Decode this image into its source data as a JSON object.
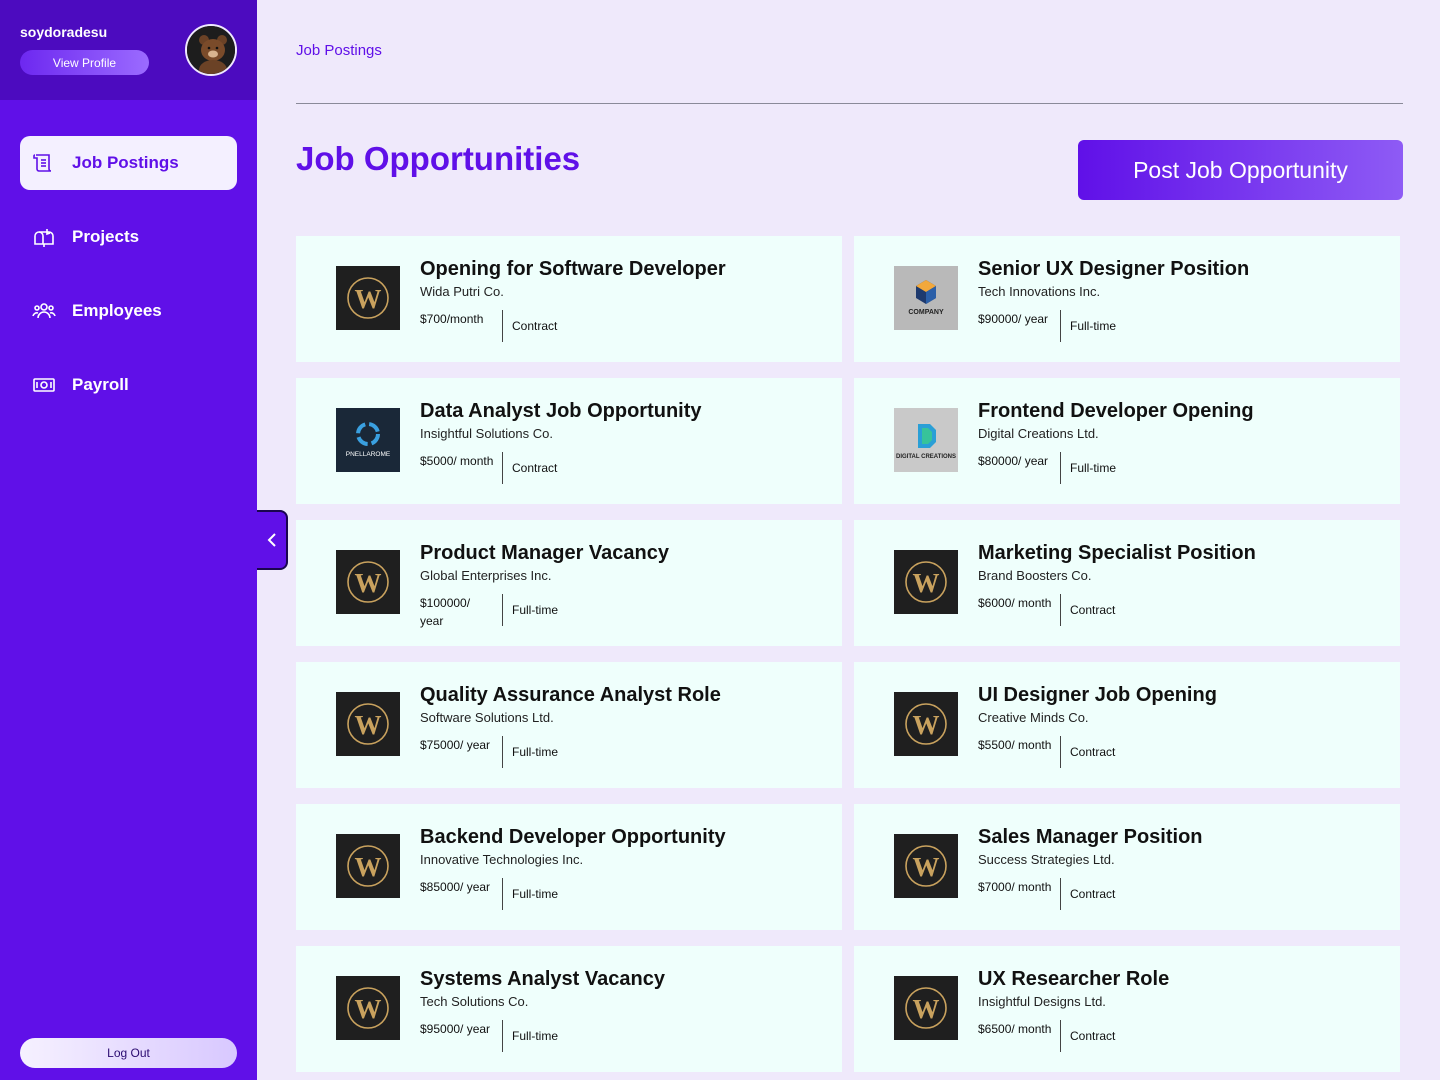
{
  "sidebar": {
    "username": "soydoradesu",
    "view_profile": "View Profile",
    "items": [
      {
        "label": "Job Postings",
        "icon": "scroll-icon"
      },
      {
        "label": "Projects",
        "icon": "mailbox-icon"
      },
      {
        "label": "Employees",
        "icon": "users-icon"
      },
      {
        "label": "Payroll",
        "icon": "cash-icon"
      }
    ],
    "logout": "Log Out"
  },
  "header": {
    "breadcrumb": "Job Postings",
    "title": "Job Opportunities",
    "post_button": "Post Job Opportunity"
  },
  "jobs": [
    {
      "title": "Opening for Software Developer",
      "company": "Wida Putri Co.",
      "salary": "$700/month",
      "type": "Contract",
      "logo": "w-logo"
    },
    {
      "title": "Senior UX Designer Position",
      "company": "Tech Innovations Inc.",
      "salary": "$90000/ year",
      "type": "Full-time",
      "logo": "company-cube-logo"
    },
    {
      "title": "Data Analyst Job Opportunity",
      "company": "Insightful Solutions Co.",
      "salary": "$5000/ month",
      "type": "Contract",
      "logo": "pnellarome-logo"
    },
    {
      "title": "Frontend Developer Opening",
      "company": "Digital Creations Ltd.",
      "salary": "$80000/ year",
      "type": "Full-time",
      "logo": "digital-creations-logo"
    },
    {
      "title": "Product Manager Vacancy",
      "company": "Global Enterprises Inc.",
      "salary": "$100000/ year",
      "type": "Full-time",
      "logo": "w-logo"
    },
    {
      "title": "Marketing Specialist Position",
      "company": "Brand Boosters Co.",
      "salary": "$6000/ month",
      "type": "Contract",
      "logo": "w-logo"
    },
    {
      "title": "Quality Assurance Analyst Role",
      "company": "Software Solutions Ltd.",
      "salary": "$75000/ year",
      "type": "Full-time",
      "logo": "w-logo"
    },
    {
      "title": "UI Designer Job Opening",
      "company": "Creative Minds Co.",
      "salary": "$5500/ month",
      "type": "Contract",
      "logo": "w-logo"
    },
    {
      "title": "Backend Developer Opportunity",
      "company": "Innovative Technologies Inc.",
      "salary": "$85000/ year",
      "type": "Full-time",
      "logo": "w-logo"
    },
    {
      "title": "Sales Manager Position",
      "company": "Success Strategies Ltd.",
      "salary": "$7000/ month",
      "type": "Contract",
      "logo": "w-logo"
    },
    {
      "title": "Systems Analyst Vacancy",
      "company": "Tech Solutions Co.",
      "salary": "$95000/ year",
      "type": "Full-time",
      "logo": "w-logo"
    },
    {
      "title": "UX Researcher Role",
      "company": "Insightful Designs Ltd.",
      "salary": "$6500/ month",
      "type": "Contract",
      "logo": "w-logo"
    }
  ],
  "colors": {
    "accent": "#6010e8",
    "sidebar_dark": "#4c0bbf",
    "page_bg": "#efe9fb",
    "card_bg": "#effffc"
  }
}
